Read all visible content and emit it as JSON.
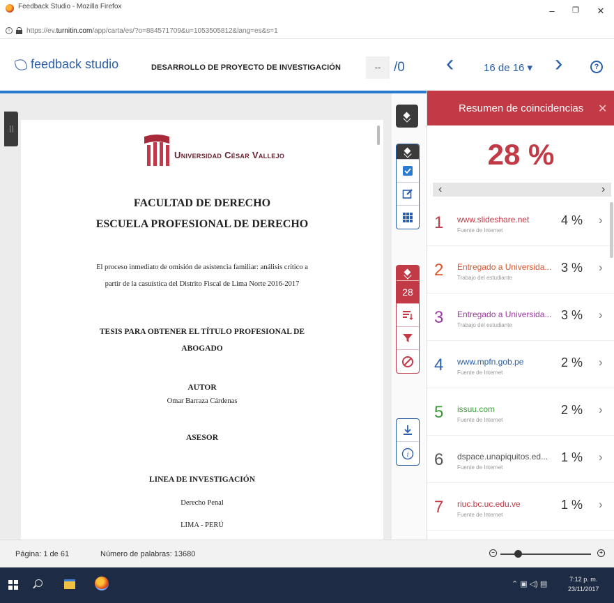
{
  "browser": {
    "window_title": "Feedback Studio - Mozilla Firefox",
    "url_prefix": "https://ev.",
    "url_domain": "turnitin.com",
    "url_rest": "/app/carta/es/?o=884571709&u=1053505812&lang=es&s=1"
  },
  "header": {
    "brand": "feedback studio",
    "doc_title": "DESARROLLO DE PROYECTO DE INVESTIGACIÓN",
    "score_placeholder": "--",
    "score_total": "/0",
    "paper_nav": "16 de 16 ▾"
  },
  "document": {
    "university": "Universidad César Vallejo",
    "faculty": "FACULTAD DE DERECHO",
    "school": "ESCUELA PROFESIONAL DE DERECHO",
    "thesis_title_line1": "El proceso inmediato de omisión de asistencia familiar: análisis crítico a",
    "thesis_title_line2": "partir de la casuística del Distrito Fiscal de Lima Norte  2016-2017",
    "degree_line1": "TESIS PARA OBTENER EL TÍTULO PROFESIONAL DE",
    "degree_line2": "ABOGADO",
    "author_label": "AUTOR",
    "author_name": "Omar Barraza Cárdenas",
    "advisor_label": "ASESOR",
    "research_line_label": "LINEA DE INVESTIGACIÓN",
    "research_line": "Derecho Penal",
    "location": "LIMA - PERÚ"
  },
  "toolbar": {
    "match_count": "28"
  },
  "panel": {
    "title": "Resumen de coincidencias",
    "overall_score": "28 %",
    "matches": [
      {
        "rank": "1",
        "source": "www.slideshare.net",
        "type": "Fuente de Internet",
        "percent": "4 %",
        "color": "#c13a45"
      },
      {
        "rank": "2",
        "source": "Entregado a Universida...",
        "type": "Trabajo del estudiante",
        "percent": "3 %",
        "color": "#d9552c"
      },
      {
        "rank": "3",
        "source": "Entregado a Universida...",
        "type": "Trabajo del estudiante",
        "percent": "3 %",
        "color": "#9a3aa0"
      },
      {
        "rank": "4",
        "source": "www.mpfn.gob.pe",
        "type": "Fuente de Internet",
        "percent": "2 %",
        "color": "#2a5ea8"
      },
      {
        "rank": "5",
        "source": "issuu.com",
        "type": "Fuente de Internet",
        "percent": "2 %",
        "color": "#3a9a3a"
      },
      {
        "rank": "6",
        "source": "dspace.unapiquitos.ed...",
        "type": "Fuente de Internet",
        "percent": "1 %",
        "color": "#555555"
      },
      {
        "rank": "7",
        "source": "riuc.bc.uc.edu.ve",
        "type": "Fuente de Internet",
        "percent": "1 %",
        "color": "#c13a45"
      }
    ]
  },
  "status": {
    "page": "Página: 1 de 61",
    "words": "Número de palabras: 13680"
  },
  "taskbar": {
    "time": "7:12 p. m.",
    "date": "23/11/2017"
  },
  "colors": {
    "accent": "#2a5ea8",
    "match_red": "#c13a45"
  }
}
